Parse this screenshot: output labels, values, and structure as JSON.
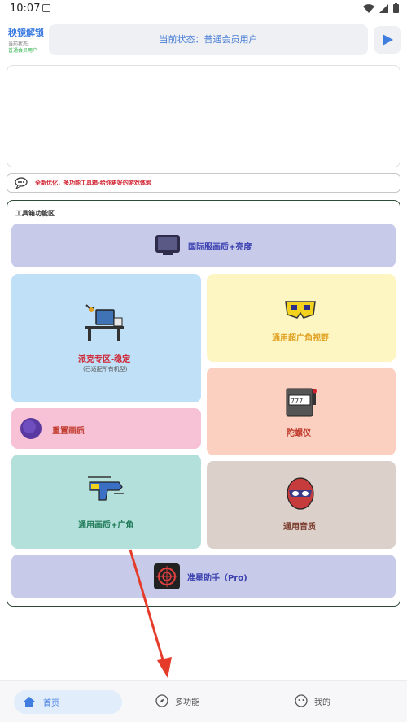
{
  "status_bar": {
    "time": "10:07"
  },
  "header": {
    "title": "秧镜解锁",
    "subtitle_1": "当前状态:",
    "subtitle_2": "普通会员用户",
    "status_text": "当前状态：普通会员用户"
  },
  "notice": {
    "text": "全新优化，多功能工具箱-给你更好的游戏体验"
  },
  "toolbox": {
    "title": "工具箱功能区",
    "tiles": [
      {
        "label": "国际服画质+亮度",
        "bg": "#c7cbe9",
        "color": "#3a3fb0"
      },
      {
        "label": "派克专区-稳定",
        "sub": "(已适配所有机型)",
        "bg": "#bfe0f7",
        "color": "#d0202e"
      },
      {
        "label": "通用超广角视野",
        "bg": "#fdf6c3",
        "color": "#e0a020"
      },
      {
        "label": "陀螺仪",
        "bg": "#fbd0c0",
        "color": "#c0392b"
      },
      {
        "label": "重置画质",
        "bg": "#f7c1d6",
        "color": "#c0392b"
      },
      {
        "label": "通用画质+广角",
        "bg": "#b4e0dc",
        "color": "#1f7a57"
      },
      {
        "label": "通用音质",
        "bg": "#dcd0cb",
        "color": "#7a3b2b"
      },
      {
        "label": "准星助手（Pro)",
        "bg": "#c7cbe9",
        "color": "#3a3fb0"
      }
    ]
  },
  "bottom_nav": {
    "home": "首页",
    "features": "多功能",
    "mine": "我的"
  },
  "colors": {
    "accent": "#3f7de0",
    "annotation_arrow": "#e53b2a"
  }
}
